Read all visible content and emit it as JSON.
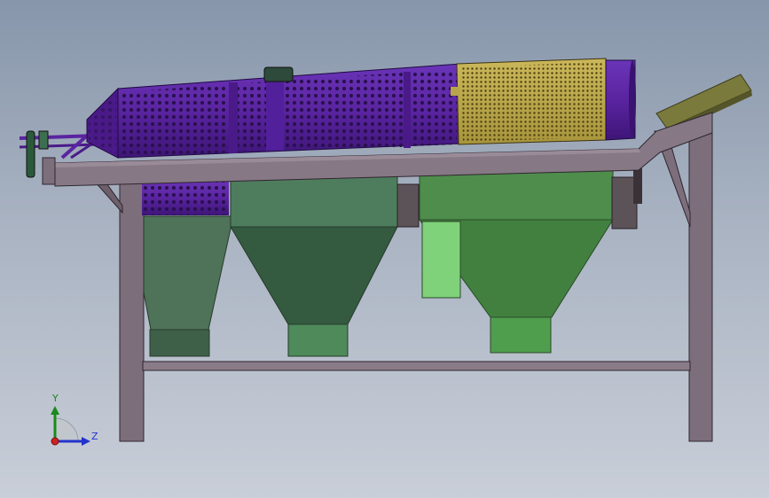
{
  "viewport": {
    "background_top": "#8796ab",
    "background_bottom": "#c9ced8"
  },
  "model": {
    "frame_color": "#7d6e7c",
    "drum_color": "#5a24a0",
    "fine_screen_color": "#b8a54a",
    "hopper_colors": [
      "#4e7358",
      "#3f6e50",
      "#4f8d4c"
    ],
    "outlet_chute_color": "#7fd27a",
    "feed_chute_color": "#7a7a3c"
  },
  "triad": {
    "y_label": "Y",
    "z_label": "Z",
    "y_color": "#1a8a1a",
    "z_color": "#2233cc",
    "x_color": "#cc2222"
  }
}
